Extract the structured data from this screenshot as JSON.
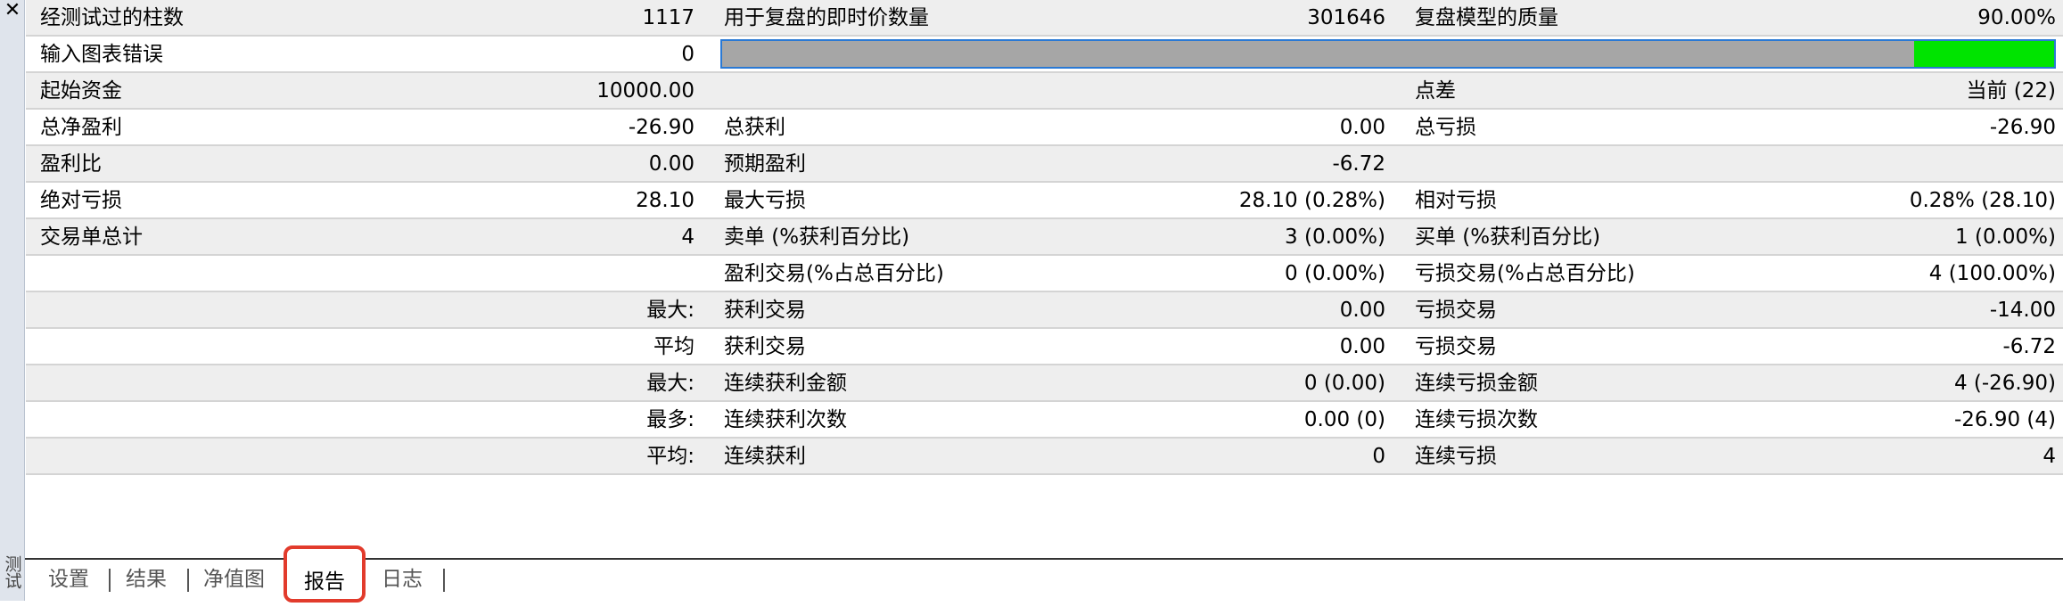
{
  "window": {
    "close_glyph": "✕",
    "side_label": "测试"
  },
  "report": {
    "quality_fraction": 0.9,
    "rows": [
      {
        "l1": "经测试过的柱数",
        "v1": "1117",
        "l2": "用于复盘的即时价数量",
        "v2": "301646",
        "l3": "复盘模型的质量",
        "v3": "90.00%"
      },
      {
        "l1": "输入图表错误",
        "v1": "0",
        "l2": "",
        "v2": "",
        "l3": "",
        "v3": ""
      },
      {
        "l1": "起始资金",
        "v1": "10000.00",
        "l2": "",
        "v2": "",
        "l3": "点差",
        "v3": "当前 (22)"
      },
      {
        "l1": "总净盈利",
        "v1": "-26.90",
        "l2": "总获利",
        "v2": "0.00",
        "l3": "总亏损",
        "v3": "-26.90"
      },
      {
        "l1": "盈利比",
        "v1": "0.00",
        "l2": "预期盈利",
        "v2": "-6.72",
        "l3": "",
        "v3": ""
      },
      {
        "l1": "绝对亏损",
        "v1": "28.10",
        "l2": "最大亏损",
        "v2": "28.10 (0.28%)",
        "l3": "相对亏损",
        "v3": "0.28% (28.10)"
      },
      {
        "l1": "交易单总计",
        "v1": "4",
        "l2": "卖单 (%获利百分比)",
        "v2": "3 (0.00%)",
        "l3": "买单 (%获利百分比)",
        "v3": "1 (0.00%)"
      },
      {
        "l1": "",
        "v1": "",
        "l2": "盈利交易(%占总百分比)",
        "v2": "0 (0.00%)",
        "l3": "亏损交易(%占总百分比)",
        "v3": "4 (100.00%)"
      },
      {
        "l1": "",
        "v1": "最大:",
        "l2": "获利交易",
        "v2": "0.00",
        "l3": "亏损交易",
        "v3": "-14.00"
      },
      {
        "l1": "",
        "v1": "平均",
        "l2": "获利交易",
        "v2": "0.00",
        "l3": "亏损交易",
        "v3": "-6.72"
      },
      {
        "l1": "",
        "v1": "最大:",
        "l2": "连续获利金额",
        "v2": "0 (0.00)",
        "l3": "连续亏损金额",
        "v3": "4 (-26.90)"
      },
      {
        "l1": "",
        "v1": "最多:",
        "l2": "连续获利次数",
        "v2": "0.00 (0)",
        "l3": "连续亏损次数",
        "v3": "-26.90 (4)"
      },
      {
        "l1": "",
        "v1": "平均:",
        "l2": "连续获利",
        "v2": "0",
        "l3": "连续亏损",
        "v3": "4"
      }
    ]
  },
  "tabs": [
    {
      "label": "设置",
      "active": false
    },
    {
      "label": "结果",
      "active": false
    },
    {
      "label": "净值图",
      "active": false
    },
    {
      "label": "报告",
      "active": true
    },
    {
      "label": "日志",
      "active": false
    }
  ],
  "colors": {
    "progress_bg": "#a6a6a6",
    "progress_fill": "#00e400",
    "progress_border": "#2a79d4",
    "active_tab_highlight": "#e23b2c"
  }
}
